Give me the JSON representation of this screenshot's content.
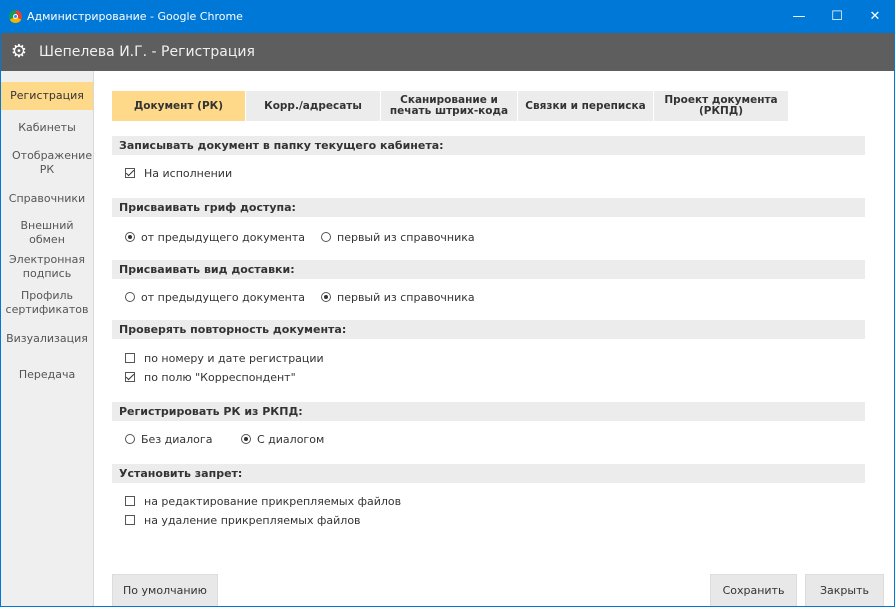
{
  "window": {
    "title": "Администрирование - Google Chrome",
    "minimize": "—",
    "maximize": "☐",
    "close": "✕"
  },
  "app": {
    "title": "Шепелева И.Г. - Регистрация",
    "settings_icon": "gear-icon"
  },
  "sidebar": {
    "items": [
      {
        "label": "Регистрация"
      },
      {
        "label": "Кабинеты"
      },
      {
        "label": "Отображение РК"
      },
      {
        "label": "Справочники"
      },
      {
        "label": "Внешний обмен"
      },
      {
        "label": "Электронная подпись"
      },
      {
        "label": "Профиль сертификатов"
      },
      {
        "label": "Визуализация"
      },
      {
        "label": "Передача"
      }
    ]
  },
  "tabs": [
    {
      "label": "Документ (РК)"
    },
    {
      "label": "Корр./адресаты"
    },
    {
      "label": "Сканирование и печать штрих-кода"
    },
    {
      "label": "Связки и переписка"
    },
    {
      "label": "Проект документа (РКПД)"
    }
  ],
  "sections": {
    "folder": {
      "header": "Записывать документ в папку текущего кабинета:",
      "options": [
        {
          "label": "На исполнении",
          "checked": true
        }
      ]
    },
    "access": {
      "header": "Присваивать гриф доступа:",
      "options": [
        {
          "label": "от предыдущего документа",
          "checked": true
        },
        {
          "label": "первый из справочника",
          "checked": false
        }
      ]
    },
    "delivery": {
      "header": "Присваивать вид доставки:",
      "options": [
        {
          "label": "от предыдущего документа",
          "checked": false
        },
        {
          "label": "первый из справочника",
          "checked": true
        }
      ]
    },
    "duplicate": {
      "header": "Проверять повторность документа:",
      "options": [
        {
          "label": "по номеру и дате регистрации",
          "checked": false
        },
        {
          "label": "по полю \"Корреспондент\"",
          "checked": true
        }
      ]
    },
    "rkpd": {
      "header": "Регистрировать РК из РКПД:",
      "options": [
        {
          "label": "Без диалога",
          "checked": false
        },
        {
          "label": "С диалогом",
          "checked": true
        }
      ]
    },
    "ban": {
      "header": "Установить запрет:",
      "options": [
        {
          "label": "на редактирование прикрепляемых файлов",
          "checked": false
        },
        {
          "label": "на удаление прикрепляемых файлов",
          "checked": false
        }
      ]
    }
  },
  "buttons": {
    "default": "По умолчанию",
    "save": "Сохранить",
    "close": "Закрыть"
  },
  "colors": {
    "titlebar": "#0078d7",
    "appbar": "#5e5e5e",
    "accent": "#ffd98a",
    "section": "#ececec"
  }
}
